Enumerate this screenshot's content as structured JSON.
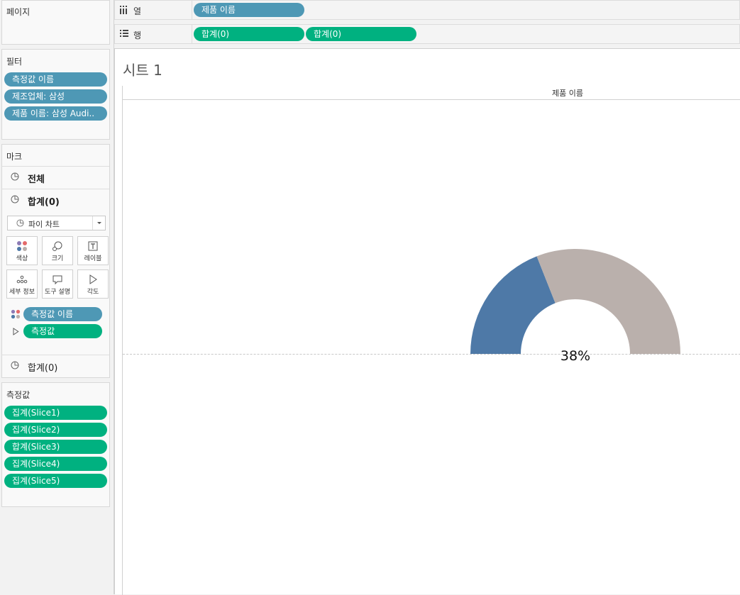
{
  "pages": {
    "title": "페이지"
  },
  "filters": {
    "title": "필터",
    "items": [
      "측정값 이름",
      "제조업체: 삼성",
      "제품 이름: 삼성 Audi.."
    ]
  },
  "marks": {
    "title": "마크",
    "rows": [
      {
        "label": "전체",
        "suffix": ""
      },
      {
        "label": "합계",
        "suffix": "(0)"
      },
      {
        "label": "합계",
        "suffix": "(0)"
      }
    ],
    "mark_type": "파이 차트",
    "buttons": [
      {
        "label": "색상",
        "icon": "color-icon"
      },
      {
        "label": "크기",
        "icon": "size-icon"
      },
      {
        "label": "레이블",
        "icon": "label-icon"
      },
      {
        "label": "세부 정보",
        "icon": "detail-icon"
      },
      {
        "label": "도구 설명",
        "icon": "tooltip-icon"
      },
      {
        "label": "각도",
        "icon": "angle-icon"
      }
    ],
    "pills": [
      {
        "label": "측정값 이름",
        "icon": "color-icon"
      },
      {
        "label": "측정값",
        "icon": "angle-icon"
      }
    ]
  },
  "measures": {
    "title": "측정값",
    "items": [
      "집계(Slice1)",
      "집계(Slice2)",
      "합계(Slice3)",
      "집계(Slice4)",
      "집계(Slice5)"
    ]
  },
  "columns_shelf": {
    "icon": "columns-icon",
    "name": "열",
    "pills": [
      "제품 이름"
    ]
  },
  "rows_shelf": {
    "icon": "rows-icon",
    "name": "행",
    "pills": [
      "합계(0)",
      "합계(0)"
    ]
  },
  "sheet": {
    "title": "시트 1",
    "header": "제품 이름"
  },
  "chart_data": {
    "type": "pie",
    "style": "semi-donut gauge",
    "center_label": "38%",
    "slices": [
      {
        "value": 38,
        "color": "#4e79a7"
      },
      {
        "value": 62,
        "color": "#bab0ac"
      }
    ]
  },
  "colors": {
    "pill_blue": "#4e98b5",
    "pill_green": "#00b180",
    "slice_blue": "#4e79a7",
    "slice_gray": "#bab0ac"
  }
}
